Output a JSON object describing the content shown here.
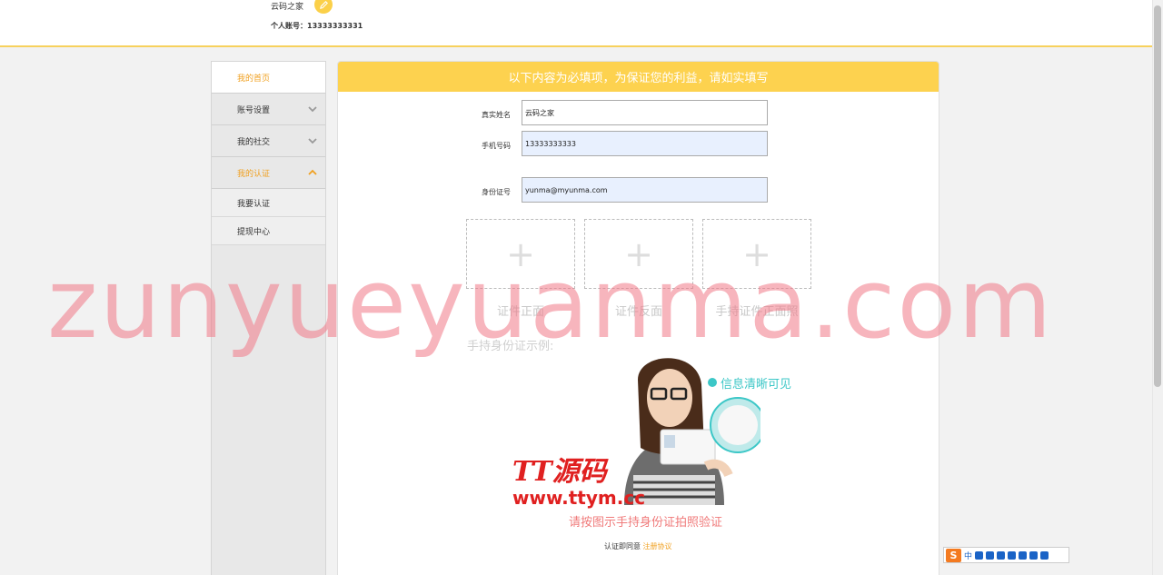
{
  "header": {
    "user_name": "云码之家",
    "account_line": "个人账号：13333333331"
  },
  "sidebar": {
    "items": [
      {
        "label": "我的首页"
      },
      {
        "label": "账号设置"
      },
      {
        "label": "我的社交"
      },
      {
        "label": "我的认证"
      }
    ],
    "sub_items": [
      {
        "label": "我要认证"
      },
      {
        "label": "提现中心"
      }
    ]
  },
  "main": {
    "banner": "以下内容为必填项，为保证您的利益，请如实填写",
    "form": {
      "name_label": "真实姓名",
      "name_value": "云码之家",
      "phone_label": "手机号码",
      "phone_value": "13333333333",
      "id_label": "身份证号",
      "id_value": "yunma@myunma.com"
    },
    "uploads": [
      {
        "label": "证件正面"
      },
      {
        "label": "证件反面"
      },
      {
        "label": "手持证件正面照"
      }
    ],
    "example_title": "手持身份证示例:",
    "info_clear": "信息清晰可见",
    "verify_hint": "请按图示手持身份证拍照验证",
    "agree_prefix": "认证即同意",
    "agree_link": "注册协议"
  },
  "watermarks": {
    "main": "zunyueyuanma.com",
    "tt": "TT源码",
    "url": "www.ttym.cc"
  },
  "ime": {
    "logo": "S",
    "mode": "中"
  },
  "colors": {
    "accent": "#fdd24f",
    "active_text": "#f0a020",
    "info": "#3cc7c7"
  }
}
